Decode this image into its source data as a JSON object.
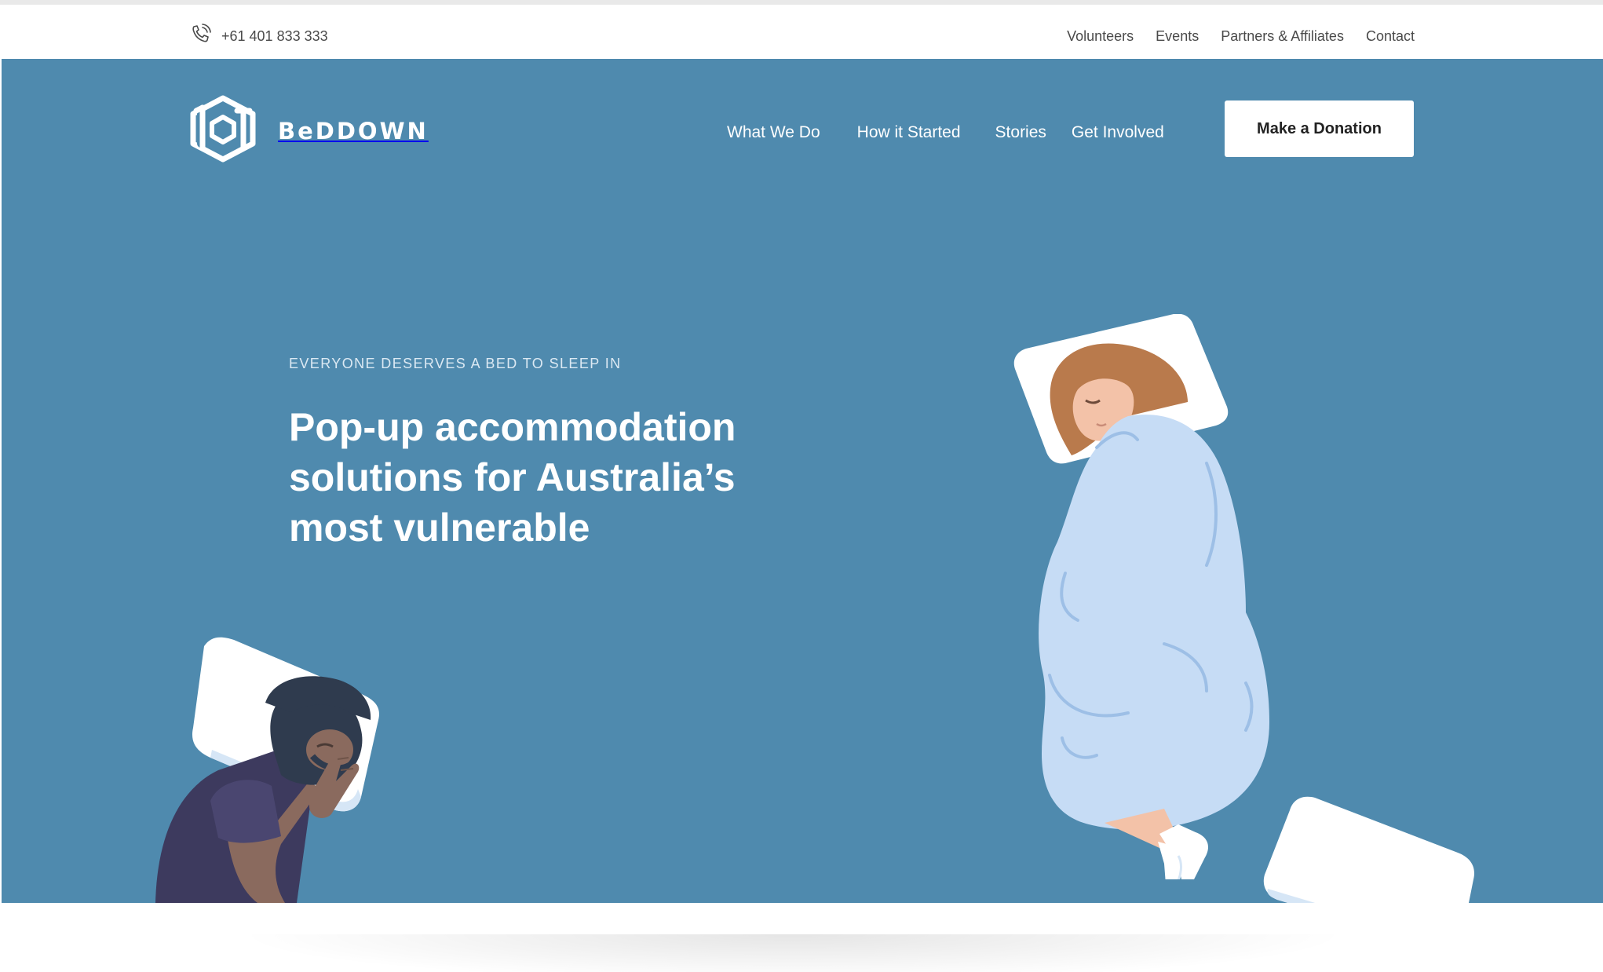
{
  "utility_bar": {
    "phone": "+61 401 833 333",
    "phone_icon": "phone-icon",
    "links": [
      "Volunteers",
      "Events",
      "Partners & Affiliates",
      "Contact"
    ]
  },
  "header": {
    "logo_text": "BeDDOWN",
    "logo_icon": "beddown-logo-icon",
    "nav": [
      "What We Do",
      "How it Started",
      "Stories",
      "Get Involved"
    ],
    "cta_label": "Make a Donation"
  },
  "hero": {
    "eyebrow": "EVERYONE DESERVES A BED TO SLEEP IN",
    "headline": "Pop-up accommodation solutions for Australia’s most vulnerable"
  },
  "colors": {
    "hero_bg": "#4f8aae",
    "blanket": "#c6dcf5",
    "pillow": "#ffffff",
    "hair": "#b97a4c",
    "man_shirt": "#3d3a5e",
    "man_skin": "#8a6a5e"
  }
}
